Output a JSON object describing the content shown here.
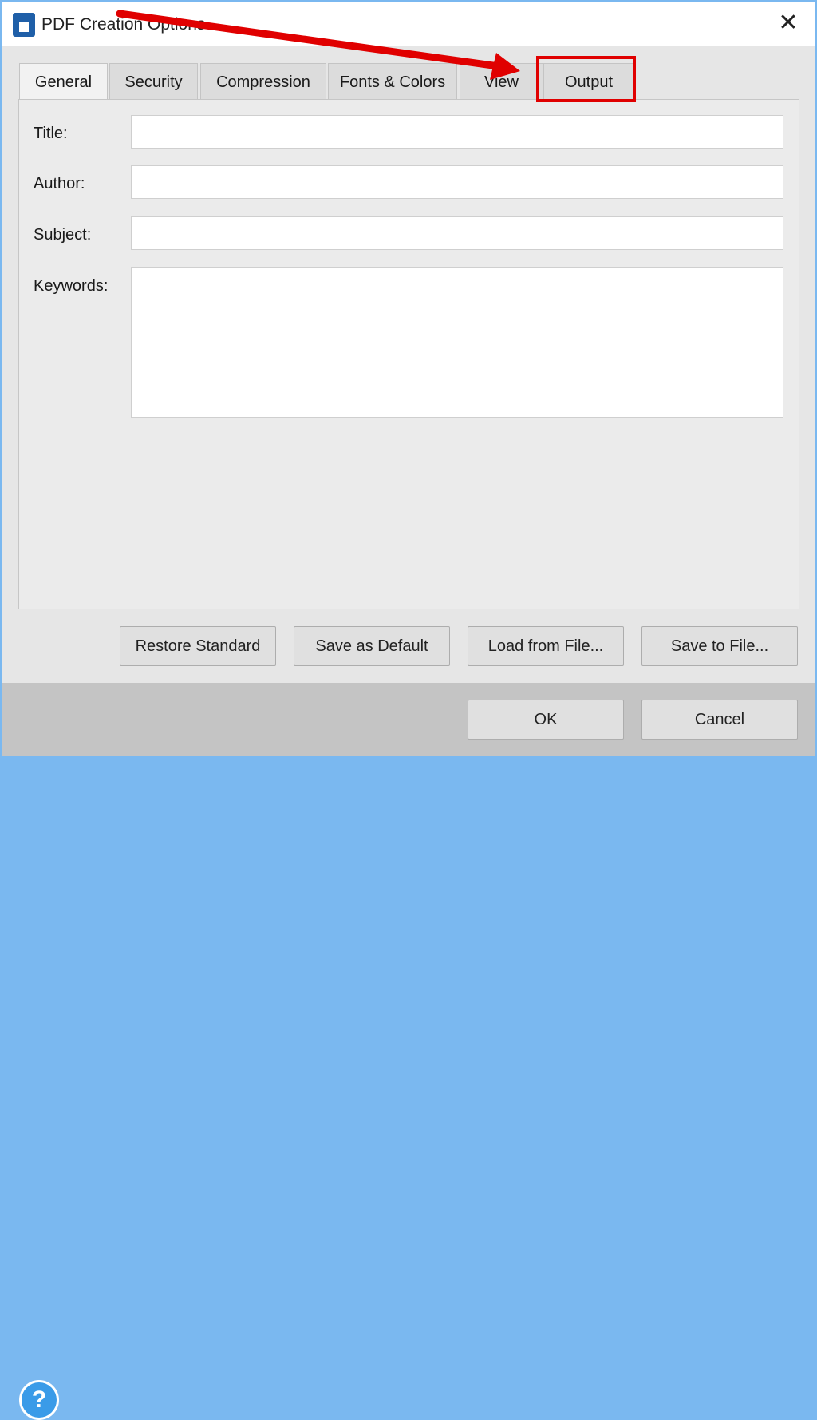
{
  "window": {
    "title": "PDF Creation Options",
    "close_icon": "close-icon"
  },
  "tabs": [
    {
      "label": "General",
      "selected": true
    },
    {
      "label": "Security"
    },
    {
      "label": "Compression"
    },
    {
      "label": "Fonts & Colors"
    },
    {
      "label": "View"
    },
    {
      "label": "Output",
      "highlighted": true
    }
  ],
  "fields": {
    "title": {
      "label": "Title:",
      "value": ""
    },
    "author": {
      "label": "Author:",
      "value": ""
    },
    "subject": {
      "label": "Subject:",
      "value": ""
    },
    "keywords": {
      "label": "Keywords:",
      "value": ""
    }
  },
  "buttons": {
    "restore": "Restore Standard",
    "save_default": "Save as Default",
    "load": "Load from File...",
    "save_file": "Save to File...",
    "ok": "OK",
    "cancel": "Cancel",
    "help": "?"
  },
  "annotation": {
    "color": "#e00000",
    "type": "arrow pointing to Output tab"
  }
}
